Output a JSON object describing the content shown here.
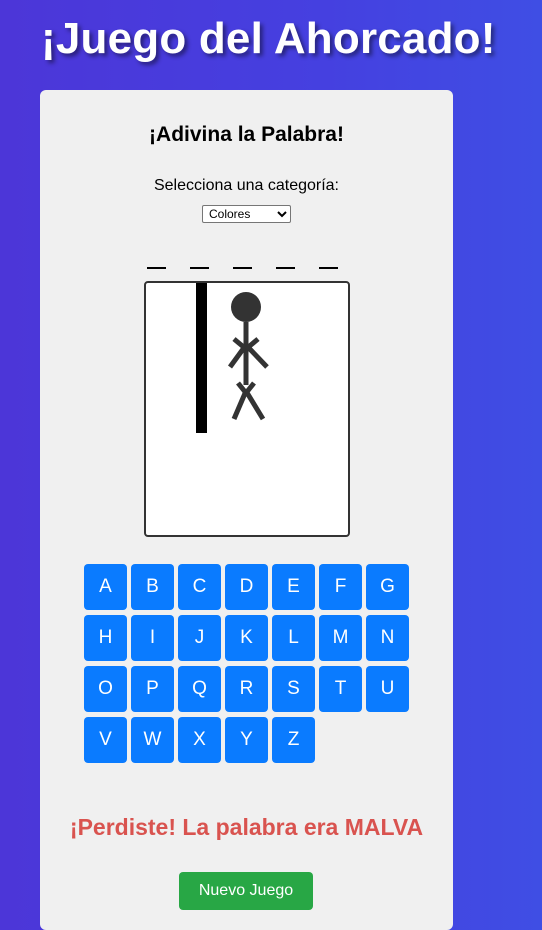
{
  "page": {
    "title": "¡Juego del Ahorcado!",
    "background_colors": [
      "#4c36d8",
      "#3f4ee4"
    ]
  },
  "card": {
    "title": "¡Adivina la Palabra!",
    "category_label": "Selecciona una categoría:",
    "category_selected": "Colores"
  },
  "word": {
    "letters_shown": [
      "",
      "",
      "",
      "",
      ""
    ],
    "length": 5
  },
  "hangman": {
    "parts_drawn": [
      "post",
      "head",
      "body",
      "left-arm",
      "right-arm",
      "left-leg",
      "right-leg"
    ]
  },
  "keyboard": {
    "keys": [
      "A",
      "B",
      "C",
      "D",
      "E",
      "F",
      "G",
      "H",
      "I",
      "J",
      "K",
      "L",
      "M",
      "N",
      "O",
      "P",
      "Q",
      "R",
      "S",
      "T",
      "U",
      "V",
      "W",
      "X",
      "Y",
      "Z"
    ],
    "key_color": "#0a7bff"
  },
  "result": {
    "message": "¡Perdiste! La palabra era MALVA",
    "color": "#d9534f"
  },
  "actions": {
    "new_game_label": "Nuevo Juego",
    "new_game_color": "#28a745"
  }
}
